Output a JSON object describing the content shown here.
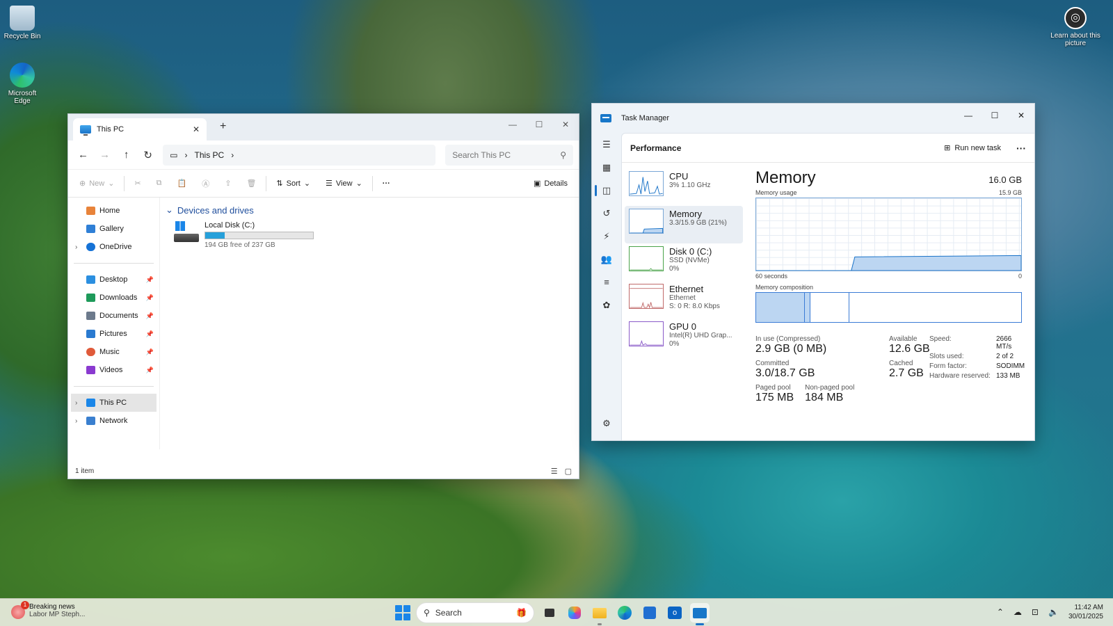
{
  "desktop": {
    "icons": [
      {
        "label": "Recycle Bin"
      },
      {
        "label": "Microsoft Edge"
      }
    ],
    "learn_about": "Learn about this picture"
  },
  "explorer": {
    "tab_title": "This PC",
    "breadcrumb": "This PC",
    "search_placeholder": "Search This PC",
    "commands": {
      "new": "New",
      "sort": "Sort",
      "view": "View",
      "details": "Details"
    },
    "sidebar": {
      "top": [
        "Home",
        "Gallery",
        "OneDrive"
      ],
      "pinned": [
        "Desktop",
        "Downloads",
        "Documents",
        "Pictures",
        "Music",
        "Videos"
      ],
      "bottom": [
        "This PC",
        "Network"
      ]
    },
    "group_header": "Devices and drives",
    "drive": {
      "name": "Local Disk (C:)",
      "free_text": "194 GB free of 237 GB",
      "used_fraction": 0.18
    },
    "status": "1 item"
  },
  "task_manager": {
    "title": "Task Manager",
    "section": "Performance",
    "run_new_task": "Run new task",
    "perf_items": [
      {
        "name": "CPU",
        "sub1": "3% 1.10 GHz",
        "sub2": ""
      },
      {
        "name": "Memory",
        "sub1": "3.3/15.9 GB (21%)",
        "sub2": ""
      },
      {
        "name": "Disk 0 (C:)",
        "sub1": "SSD (NVMe)",
        "sub2": "0%"
      },
      {
        "name": "Ethernet",
        "sub1": "Ethernet",
        "sub2": "S: 0 R: 8.0 Kbps"
      },
      {
        "name": "GPU 0",
        "sub1": "Intel(R) UHD Grap...",
        "sub2": "0%"
      }
    ],
    "memory": {
      "title": "Memory",
      "total": "16.0 GB",
      "usage_label": "Memory usage",
      "usage_max": "15.9 GB",
      "axis_left": "60 seconds",
      "axis_right": "0",
      "composition_label": "Memory composition",
      "in_use_label": "In use (Compressed)",
      "in_use": "2.9 GB (0 MB)",
      "available_label": "Available",
      "available": "12.6 GB",
      "committed_label": "Committed",
      "committed": "3.0/18.7 GB",
      "cached_label": "Cached",
      "cached": "2.7 GB",
      "paged_label": "Paged pool",
      "paged": "175 MB",
      "nonpaged_label": "Non-paged pool",
      "nonpaged": "184 MB",
      "hw": [
        {
          "k": "Speed:",
          "v": "2666 MT/s"
        },
        {
          "k": "Slots used:",
          "v": "2 of 2"
        },
        {
          "k": "Form factor:",
          "v": "SODIMM"
        },
        {
          "k": "Hardware reserved:",
          "v": "133 MB"
        }
      ]
    }
  },
  "taskbar": {
    "news_title": "Breaking news",
    "news_sub": "Labor MP Steph...",
    "news_badge": "1",
    "search": "Search",
    "time": "11:42 AM",
    "date": "30/01/2025"
  }
}
